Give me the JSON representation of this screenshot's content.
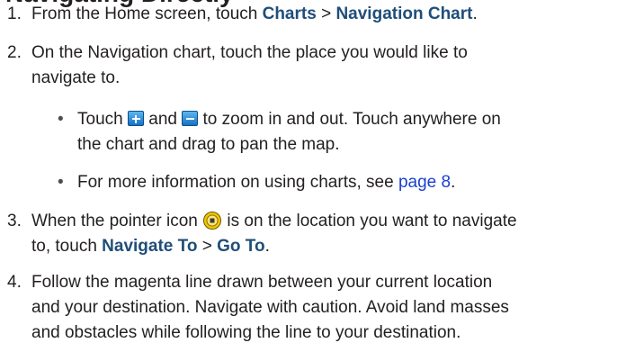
{
  "heading": "Navigating Directly",
  "steps": [
    {
      "num": "1.",
      "lines": {
        "l1_a": "From the Home screen, touch ",
        "l1_b": "Charts",
        "l1_c": " > ",
        "l1_d": "Navigation Chart",
        "l1_e": "."
      }
    },
    {
      "num": "2.",
      "lines": {
        "l1": "On the Navigation chart, touch the place you would like to",
        "l2": "navigate to."
      }
    },
    {
      "num": "3.",
      "lines": {
        "l1_a": "When the pointer icon ",
        "l1_b": " is on the location you want to navigate",
        "l2_a": "to, touch ",
        "l2_b": "Navigate To",
        "l2_c": " > ",
        "l2_d": "Go To",
        "l2_e": "."
      }
    },
    {
      "num": "4.",
      "lines": {
        "l1": "Follow the magenta line drawn between your current location",
        "l2": "and your destination. Navigate with caution. Avoid land masses",
        "l3": "and obstacles while following the line to your destination."
      }
    }
  ],
  "bullets": [
    {
      "dot": "•",
      "l1_a": "Touch ",
      "l1_b": " and ",
      "l1_c": " to zoom in and out. Touch anywhere on",
      "l2": "the chart and drag to pan the map."
    },
    {
      "dot": "•",
      "l1_a": "For more information on using charts, see ",
      "l1_b": "page 8",
      "l1_c": "."
    }
  ],
  "icons": {
    "zoom_in": "zoom-in-icon",
    "zoom_out": "zoom-out-icon",
    "pointer": "pointer-icon"
  },
  "colors": {
    "text": "#231f20",
    "ui_term": "#1f4e79",
    "link": "#1a3fd1",
    "icon_blue": "#1672c4",
    "pointer_yellow": "#f2c400"
  }
}
